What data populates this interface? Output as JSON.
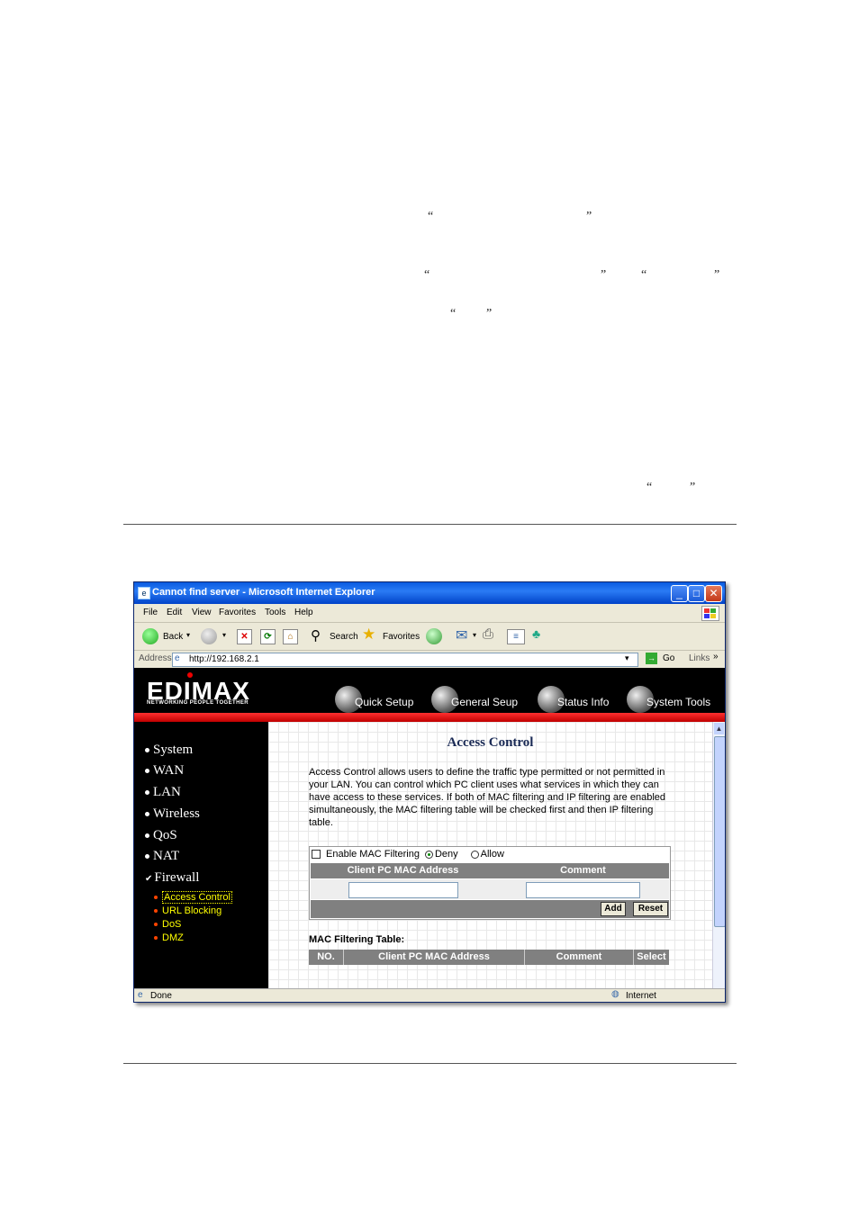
{
  "document": {
    "quotes": [
      {
        "open": "“",
        "close": "”"
      },
      {
        "open": "“",
        "close": "”"
      },
      {
        "open": "“",
        "close": "”"
      },
      {
        "open": "“",
        "close": "”"
      },
      {
        "open": "“",
        "close": "”"
      }
    ]
  },
  "browser": {
    "title": "Cannot find server - Microsoft Internet Explorer",
    "menu": [
      "File",
      "Edit",
      "View",
      "Favorites",
      "Tools",
      "Help"
    ],
    "toolbar": {
      "back": "Back",
      "search": "Search",
      "favorites": "Favorites"
    },
    "address_label": "Address",
    "address_value": "http://192.168.2.1",
    "go": "Go",
    "links": "Links",
    "status_left": "Done",
    "status_right": "Internet"
  },
  "router": {
    "logo": "EDIMAX",
    "tagline": "NETWORKING PEOPLE TOGETHER",
    "top_nav": [
      "Quick Setup",
      "General Seup",
      "Status Info",
      "System Tools"
    ],
    "sidebar": [
      "System",
      "WAN",
      "LAN",
      "Wireless",
      "QoS",
      "NAT",
      "Firewall"
    ],
    "firewall_sub": [
      "Access Control",
      "URL Blocking",
      "DoS",
      "DMZ"
    ],
    "page_title": "Access Control",
    "description": "Access Control allows users to define the traffic type permitted or not permitted in your LAN. You can control which PC client uses what services in which they can have access to these services. If both of MAC filtering and IP filtering are enabled simultaneously, the MAC filtering table will be checked first and then IP filtering table.",
    "enable_mac_label": "Enable MAC Filtering",
    "deny_label": "Deny",
    "allow_label": "Allow",
    "col_mac": "Client PC MAC Address",
    "col_comment": "Comment",
    "add_button": "Add",
    "reset_button": "Reset",
    "mac_table_title": "MAC Filtering Table:",
    "table_cols": [
      "NO.",
      "Client PC MAC Address",
      "Comment",
      "Select"
    ]
  }
}
